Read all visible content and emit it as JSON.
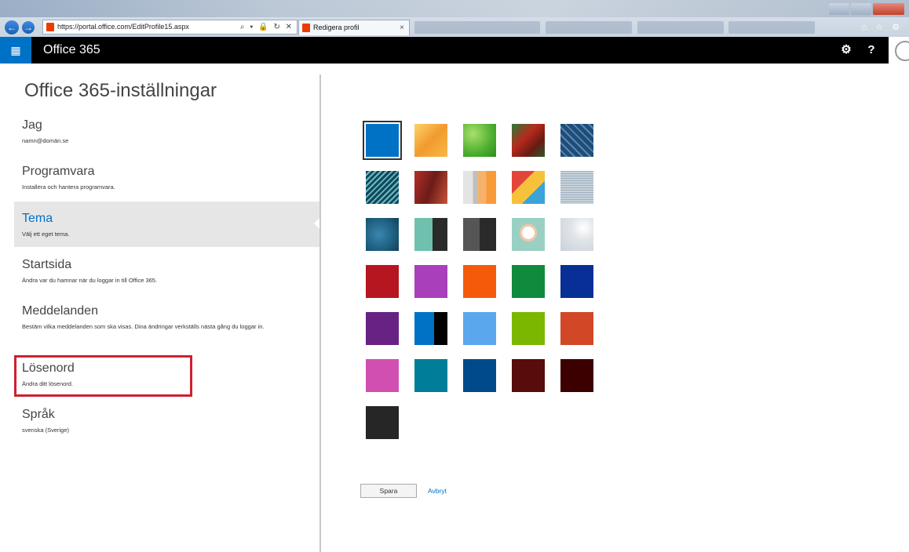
{
  "browser": {
    "address": "https://portal.office.com/EditProfile15.aspx",
    "tab_title": "Redigera profil",
    "tab_close": "×",
    "addr_tools": "⌕ ▾ 🔒 ↻ ✕",
    "back_icon": "←",
    "forward_icon": "→",
    "toolbar_icons": "⌂ ☆ ⚙"
  },
  "header": {
    "app_launcher_icon": "▦",
    "title": "Office 365",
    "settings_icon": "⚙",
    "help_label": "?"
  },
  "settings": {
    "title": "Office 365-inställningar",
    "items": [
      {
        "label": "Jag",
        "desc": "namn@domän.se"
      },
      {
        "label": "Programvara",
        "desc": "Installera och hantera programvara."
      },
      {
        "label": "Tema",
        "desc": "Välj ett eget tema."
      },
      {
        "label": "Startsida",
        "desc": "Ändra var du hamnar när du loggar in till Office 365."
      },
      {
        "label": "Meddelanden",
        "desc": "Bestäm vilka meddelanden som ska visas. Dina ändringar verkställs nästa gång du loggar in."
      },
      {
        "label": "Lösenord",
        "desc": "Ändra ditt lösenord."
      },
      {
        "label": "Språk",
        "desc": "svenska (Sverige)"
      }
    ],
    "selected": "Tema"
  },
  "themes": {
    "colors": [
      "#0072c6",
      "#f4b24a",
      "#5fbf3c",
      "#9c2a1c",
      "#1e4d7a",
      "#1a5a6a",
      "#8a2a24",
      "#d8d8d8",
      "#f2a93b",
      "#c7d2da",
      "#1d5f7f",
      "#6fc0ac",
      "#555555",
      "#f1e9d6",
      "#e3e7ea",
      "#b6161f",
      "#a93fbb",
      "#f55a0b",
      "#108a3d",
      "#072f96",
      "#672283",
      "#0072c6",
      "#5ba7ee",
      "#7cb700",
      "#d24726",
      "#d24fb2",
      "#007e99",
      "#004a8c",
      "#580c0c",
      "#3d0000",
      "#262626"
    ],
    "selected_index": 0
  },
  "actions": {
    "save_label": "Spara",
    "cancel_label": "Avbryt"
  }
}
